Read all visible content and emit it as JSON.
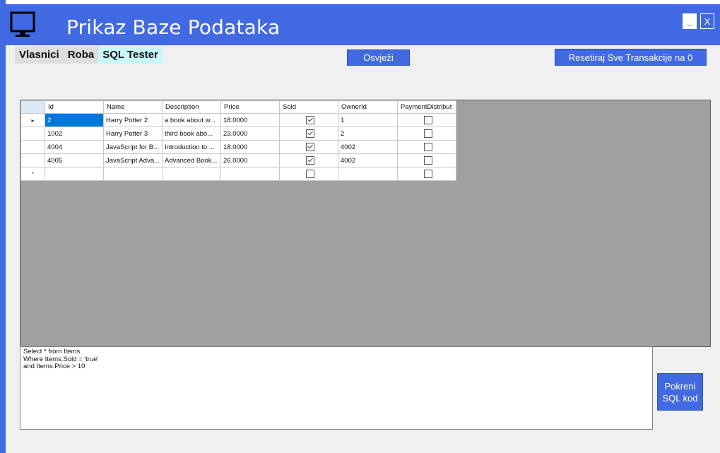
{
  "window": {
    "title": "Prikaz Baze Podataka",
    "minimize_label": "_",
    "close_label": "X",
    "icon": "monitor-icon"
  },
  "tabs": [
    {
      "label": "Vlasnici",
      "active": false
    },
    {
      "label": "Roba",
      "active": false
    },
    {
      "label": "SQL Tester",
      "active": true
    }
  ],
  "toolbar": {
    "refresh_label": "Osvježi",
    "reset_label": "Resetiraj Sve Transakcije na 0"
  },
  "grid": {
    "columns": [
      "Id",
      "Name",
      "Description",
      "Price",
      "Sold",
      "OwnerId",
      "PaymentDistribut"
    ],
    "rows": [
      {
        "marker": "▸",
        "id": "2",
        "name": "Harry Potter 2",
        "description": "a book about w...",
        "price": "18.0000",
        "sold": true,
        "owner": "1",
        "payment": false
      },
      {
        "marker": "",
        "id": "1002",
        "name": "Harry Potter 3",
        "description": "third book abo...",
        "price": "23.0000",
        "sold": true,
        "owner": "2",
        "payment": false
      },
      {
        "marker": "",
        "id": "4004",
        "name": "JavaScript for B...",
        "description": "Introduction to ...",
        "price": "18.0000",
        "sold": true,
        "owner": "4002",
        "payment": false
      },
      {
        "marker": "",
        "id": "4005",
        "name": "JavaScript Adva...",
        "description": "Advanced Book...",
        "price": "26.0000",
        "sold": true,
        "owner": "4002",
        "payment": false
      }
    ],
    "new_row_marker": "*"
  },
  "sql": {
    "query": "Select * from Items\nWhere Items.Sold = 'true'\nand Items.Price > 10",
    "run_label": "Pokreni\nSQL kod"
  },
  "colors": {
    "accent": "#4169e1",
    "active_tab": "#c9f8fb",
    "grid_bg": "#a0a0a0",
    "selection": "#0078d7"
  }
}
